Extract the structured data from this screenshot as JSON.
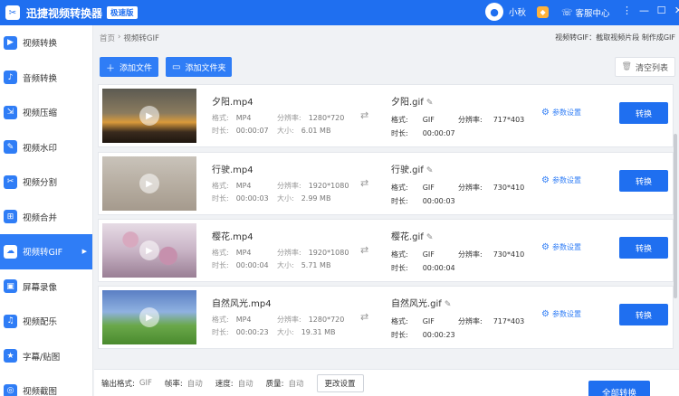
{
  "app": {
    "title": "迅捷视频转换器",
    "badge": "极速版",
    "user_name": "小秋",
    "support_label": "客服中心"
  },
  "window_controls": [
    "⋮",
    "—",
    "☐",
    "✕"
  ],
  "sidebar": {
    "items": [
      {
        "label": "视频转换",
        "icon": "video-convert-icon",
        "glyph": "▶"
      },
      {
        "label": "音频转换",
        "icon": "audio-convert-icon",
        "glyph": "♪"
      },
      {
        "label": "视频压缩",
        "icon": "video-compress-icon",
        "glyph": "⇲"
      },
      {
        "label": "视频水印",
        "icon": "watermark-icon",
        "glyph": "✎"
      },
      {
        "label": "视频分割",
        "icon": "split-icon",
        "glyph": "✂"
      },
      {
        "label": "视频合并",
        "icon": "merge-icon",
        "glyph": "⊞"
      },
      {
        "label": "视频转GIF",
        "icon": "gif-icon",
        "glyph": "☁",
        "active": true
      },
      {
        "label": "屏幕录像",
        "icon": "screen-record-icon",
        "glyph": "▣"
      },
      {
        "label": "视频配乐",
        "icon": "music-icon",
        "glyph": "♫"
      },
      {
        "label": "字幕/贴图",
        "icon": "subtitle-icon",
        "glyph": "★"
      },
      {
        "label": "视频截图",
        "icon": "screenshot-icon",
        "glyph": "◎"
      }
    ]
  },
  "breadcrumb": {
    "home": "首页",
    "sep": "›",
    "current": "视频转GIF"
  },
  "hint": "视频转GIF：截取视频片段 制作成GIF",
  "toolbar": {
    "add_file": "添加文件",
    "add_folder": "添加文件夹",
    "clear_list": "清空列表"
  },
  "labels": {
    "format": "格式:",
    "duration": "时长:",
    "resolution": "分辨率:",
    "size": "大小:",
    "param_settings": "参数设置",
    "convert": "转换"
  },
  "files": [
    {
      "name": "夕阳.mp4",
      "format": "MP4",
      "duration": "00:00:07",
      "resolution": "1280*720",
      "size": "6.01 MB",
      "out_name": "夕阳.gif",
      "out_format": "GIF",
      "out_duration": "00:00:07",
      "out_resolution": "717*403",
      "thumb": "sunset"
    },
    {
      "name": "行驶.mp4",
      "format": "MP4",
      "duration": "00:00:03",
      "resolution": "1920*1080",
      "size": "2.99 MB",
      "out_name": "行驶.gif",
      "out_format": "GIF",
      "out_duration": "00:00:03",
      "out_resolution": "730*410",
      "thumb": "desert"
    },
    {
      "name": "樱花.mp4",
      "format": "MP4",
      "duration": "00:00:04",
      "resolution": "1920*1080",
      "size": "5.71 MB",
      "out_name": "樱花.gif",
      "out_format": "GIF",
      "out_duration": "00:00:04",
      "out_resolution": "730*410",
      "thumb": "sakura"
    },
    {
      "name": "自然风光.mp4",
      "format": "MP4",
      "duration": "00:00:23",
      "resolution": "1280*720",
      "size": "19.31 MB",
      "out_name": "自然风光.gif",
      "out_format": "GIF",
      "out_duration": "00:00:23",
      "out_resolution": "717*403",
      "thumb": "nature"
    }
  ],
  "bottom": {
    "output_format_label": "输出格式:",
    "output_format": "GIF",
    "framerate_label": "帧率:",
    "framerate": "自动",
    "speed_label": "速度:",
    "speed": "自动",
    "quality_label": "质量:",
    "quality": "自动",
    "change_settings": "更改设置",
    "convert_all": "全部转换"
  },
  "colors": {
    "primary": "#1f6ff0",
    "accent": "#2f7df6",
    "vip": "#ffb23a"
  }
}
